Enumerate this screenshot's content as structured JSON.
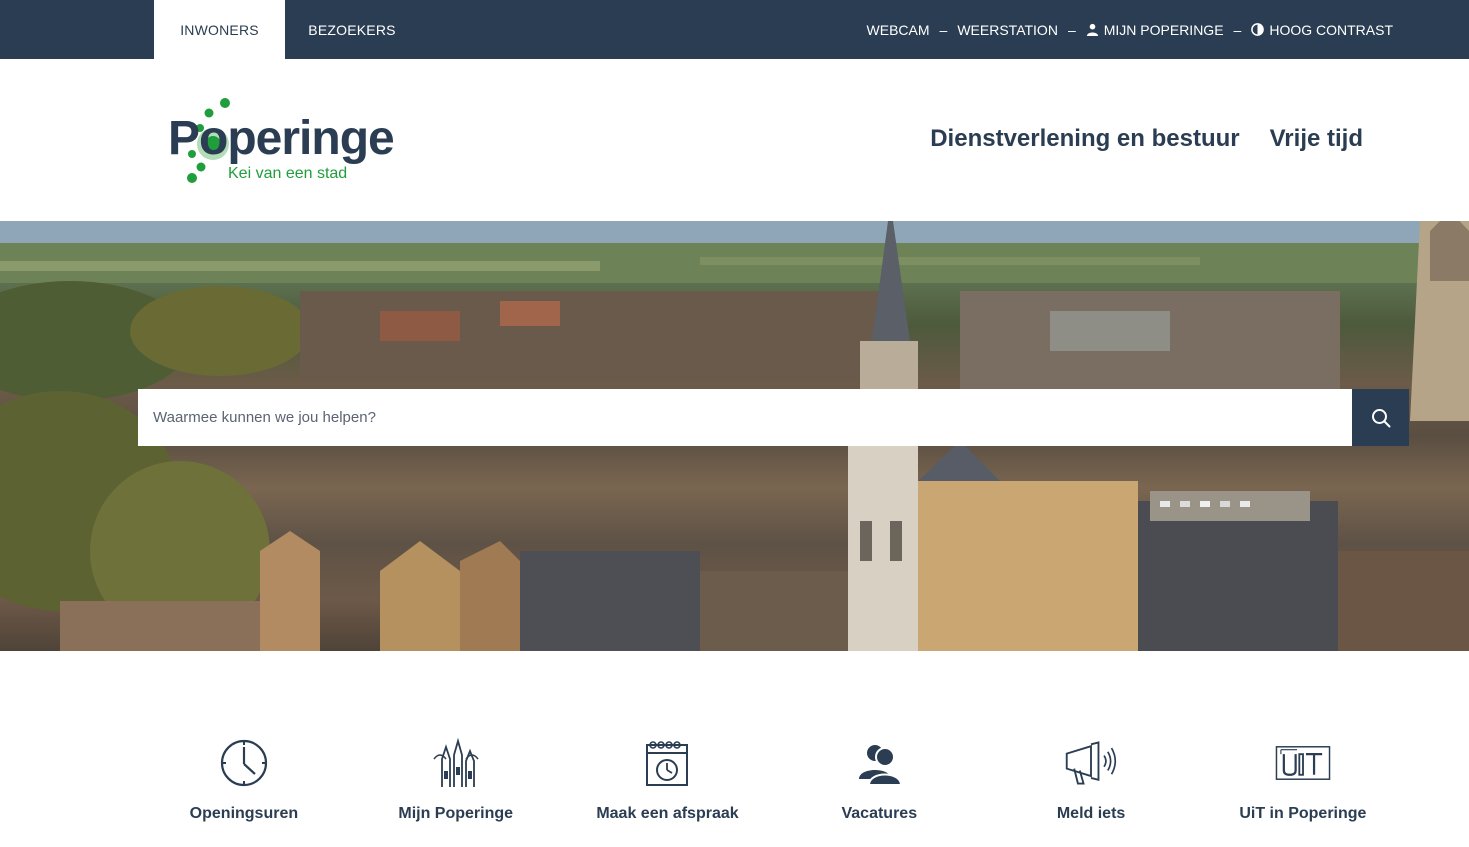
{
  "topbar": {
    "tabs": [
      {
        "label": "INWONERS",
        "active": true
      },
      {
        "label": "BEZOEKERS",
        "active": false
      }
    ],
    "links": [
      {
        "label": "WEBCAM",
        "icon": ""
      },
      {
        "label": "WEERSTATION",
        "icon": ""
      },
      {
        "label": "MIJN POPERINGE",
        "icon": "user-icon"
      },
      {
        "label": "HOOG CONTRAST",
        "icon": "contrast-icon"
      }
    ],
    "separator": "–"
  },
  "header": {
    "logo_word": "Poperinge",
    "logo_tagline": "Kei van een stad",
    "nav": [
      {
        "label": "Dienstverlening en bestuur"
      },
      {
        "label": "Vrije tijd"
      }
    ]
  },
  "search": {
    "placeholder": "Waarmee kunnen we jou helpen?",
    "icon": "search-icon"
  },
  "quicklinks": [
    {
      "label": "Openingsuren",
      "icon": "clock-icon"
    },
    {
      "label": "Mijn Poperinge",
      "icon": "towers-icon"
    },
    {
      "label": "Maak een afspraak",
      "icon": "calendar-icon"
    },
    {
      "label": "Vacatures",
      "icon": "people-icon"
    },
    {
      "label": "Meld iets",
      "icon": "megaphone-icon"
    },
    {
      "label": "UiT in Poperinge",
      "icon": "uit-icon"
    }
  ],
  "colors": {
    "navy": "#2b3d52",
    "green": "#1f9e3b",
    "white": "#ffffff"
  }
}
